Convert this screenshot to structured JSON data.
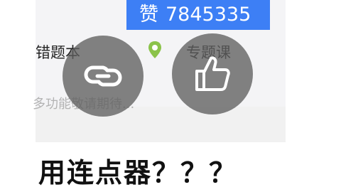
{
  "screen": {
    "like_char": "赞",
    "like_count": "7845335",
    "feature_mistakes": "错题本",
    "feature_topics": "专题课",
    "hint": "多功能敬请期待...",
    "icons": {
      "pin": "map-pin-icon",
      "link": "link-icon",
      "thumb": "thumbs-up-icon"
    },
    "colors": {
      "banner": "#3d7ff5",
      "pin": "#8bc34a",
      "fab": "#5f5f5f"
    }
  },
  "caption": "用连点器？？？"
}
